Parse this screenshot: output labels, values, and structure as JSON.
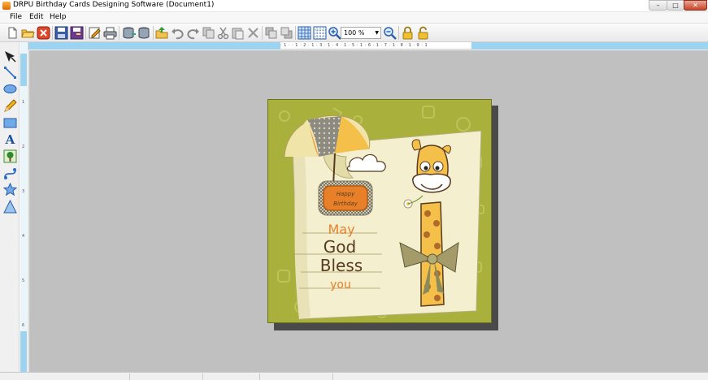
{
  "window": {
    "title": "DRPU Birthday Cards Designing Software  (Document1)",
    "minimize_glyph": "–",
    "maximize_glyph": "□",
    "close_glyph": "✕"
  },
  "menu": {
    "items": [
      "File",
      "Edit",
      "Help"
    ]
  },
  "toolbar": {
    "zoom_value": "100 %",
    "icons": [
      "new-document-icon",
      "open-folder-icon",
      "close-document-icon",
      "save-icon",
      "save-as-icon",
      "edit-icon",
      "print-icon",
      "database-export-icon",
      "database-icon",
      "open-file-icon",
      "undo-icon",
      "redo-icon",
      "copy-format-icon",
      "cut-icon",
      "paste-icon",
      "delete-icon",
      "bring-front-icon",
      "send-back-icon",
      "grid-icon",
      "snap-grid-icon",
      "zoom-in-icon",
      "zoom-dropdown",
      "zoom-out-icon",
      "lock-icon",
      "unlock-icon"
    ]
  },
  "tools": {
    "icons": [
      "pointer-icon",
      "line-icon",
      "ellipse-icon",
      "pencil-icon",
      "rectangle-icon",
      "text-icon",
      "image-icon",
      "curve-icon",
      "star-icon",
      "triangle-icon"
    ]
  },
  "ruler": {
    "horizontal_labels": "· 1 · · 1 · 2 · 1 · 3 · 1 · 4 · 1 · 5 · 1 · 6 · 1 · 7 · 1 · 8 · 1 · 9 · 1"
  },
  "card": {
    "badge_line1": "Happy",
    "badge_line2": "Birthday",
    "line1": "May",
    "line2": "God",
    "line3": "Bless",
    "line4": "you",
    "colors": {
      "background": "#a9b13c",
      "paper": "#f3efcf",
      "orange": "#e8802a",
      "brown": "#5a3b20"
    }
  }
}
